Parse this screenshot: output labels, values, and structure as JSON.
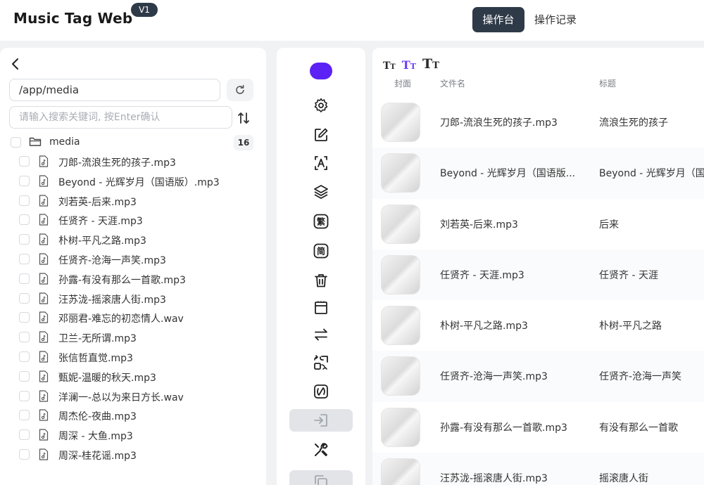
{
  "app": {
    "title": "Music Tag Web",
    "version": "V1"
  },
  "nav": {
    "active": "操作台",
    "history": "操作记录"
  },
  "left": {
    "path": "/app/media",
    "search_placeholder": "请输入搜索关键词, 按Enter确认",
    "folder": {
      "name": "media",
      "count": "16"
    },
    "files": [
      "刀郎-流浪生死的孩子.mp3",
      "Beyond - 光辉岁月（国语版）.mp3",
      "刘若英-后来.mp3",
      "任贤齐 - 天涯.mp3",
      "朴树-平凡之路.mp3",
      "任贤齐-沧海一声笑.mp3",
      "孙露-有没有那么一首歌.mp3",
      "汪苏泷-摇滚唐人街.mp3",
      "邓丽君-难忘的初恋情人.wav",
      "卫兰-无所谓.mp3",
      "张信哲直觉.mp3",
      "甄妮-温暖的秋天.mp3",
      "洋澜一-总以为来日方长.wav",
      "周杰伦-夜曲.mp3",
      "周深 - 大鱼.mp3",
      "周深-桂花谣.mp3"
    ]
  },
  "toolbar": {
    "accent": "#5b21f5",
    "tools": [
      "gear-icon",
      "edit-icon",
      "text-recognize-icon",
      "layers-icon",
      "traditional-icon",
      "simplified-icon",
      "trash-icon",
      "archive-icon",
      "swap-icon",
      "convert-icon",
      "scan-icon",
      "import-icon",
      "tools-icon",
      "copy-icon"
    ],
    "trad_char": "繁",
    "simp_char": "简"
  },
  "table": {
    "size_toggle_letter": "T",
    "size_toggle_sub": "T",
    "columns": {
      "cover": "封面",
      "filename": "文件名",
      "title": "标题"
    },
    "rows": [
      {
        "filename": "刀郎-流浪生死的孩子.mp3",
        "title": "流浪生死的孩子"
      },
      {
        "filename": "Beyond - 光辉岁月（国语版...",
        "title": "Beyond - 光辉岁月（国"
      },
      {
        "filename": "刘若英-后来.mp3",
        "title": "后来"
      },
      {
        "filename": "任贤齐 - 天涯.mp3",
        "title": "任贤齐 - 天涯"
      },
      {
        "filename": "朴树-平凡之路.mp3",
        "title": "朴树-平凡之路"
      },
      {
        "filename": "任贤齐-沧海一声笑.mp3",
        "title": "任贤齐-沧海一声笑"
      },
      {
        "filename": "孙露-有没有那么一首歌.mp3",
        "title": "有没有那么一首歌"
      },
      {
        "filename": "汪苏泷-摇滚唐人街.mp3",
        "title": "摇滚唐人街"
      }
    ]
  }
}
